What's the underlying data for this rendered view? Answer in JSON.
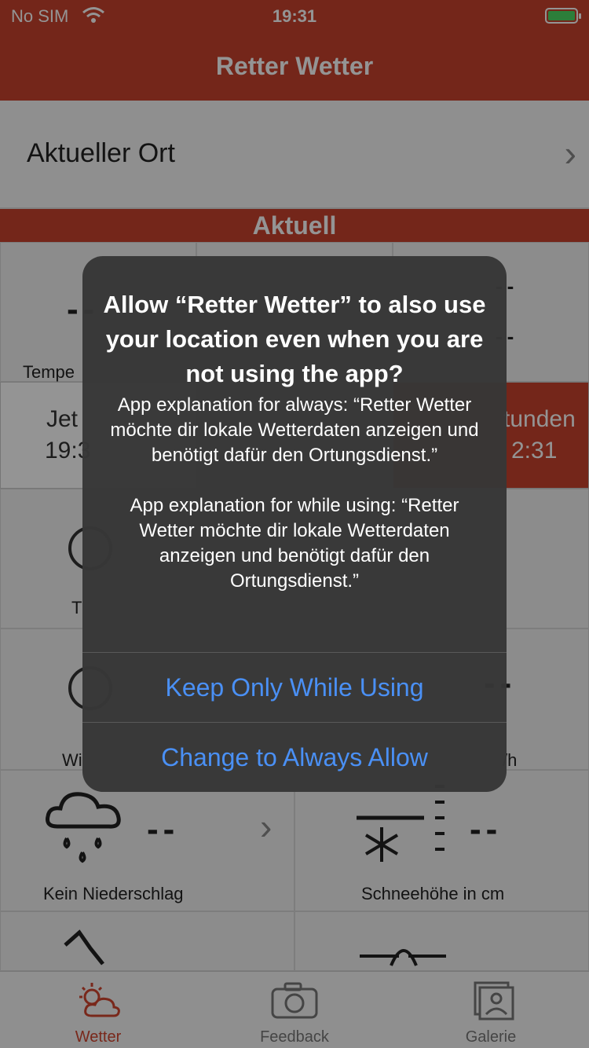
{
  "status": {
    "carrier": "No SIM",
    "time": "19:31"
  },
  "nav": {
    "title": "Retter Wetter"
  },
  "location": {
    "label": "Aktueller Ort"
  },
  "section": {
    "title": "Aktuell"
  },
  "grid": {
    "dash": "--",
    "temp_label": "Tempe",
    "tab_now": "Jet",
    "tab_now_time": "19:3",
    "tab_hours": "tunden",
    "tab_hours_time": "2:31",
    "t_label": "T",
    "wind_label": "Wi",
    "wind_unit": "/h",
    "precip_label": "Kein Niederschlag",
    "snow_label": "Schneehöhe in cm"
  },
  "alert": {
    "title": "Allow “Retter Wetter” to also use your location even when you are not using the app?",
    "message": "App explanation for always: “Retter Wetter möchte dir lokale Wetterdaten anzeigen und benötigt dafür den Ortungsdienst.”\n\nApp explanation for while using: “Retter Wetter möchte dir lokale Wetterdaten anzeigen und benötigt dafür den Ortungsdienst.”",
    "button_keep": "Keep Only While Using",
    "button_always": "Change to Always Allow"
  },
  "tabs": [
    {
      "label": "Wetter",
      "icon": "weather-icon",
      "active": true
    },
    {
      "label": "Feedback",
      "icon": "camera-icon",
      "active": false
    },
    {
      "label": "Galerie",
      "icon": "gallery-icon",
      "active": false
    }
  ],
  "colors": {
    "brand": "#c9432e",
    "accent_blue": "#4a90f5",
    "alert_bg": "#373737"
  }
}
